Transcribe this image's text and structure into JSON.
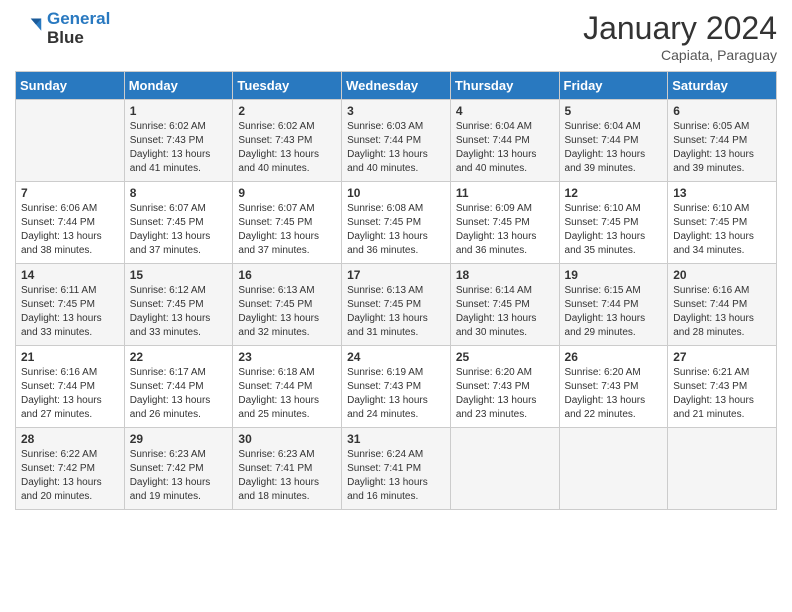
{
  "header": {
    "logo_line1": "General",
    "logo_line2": "Blue",
    "month": "January 2024",
    "location": "Capiata, Paraguay"
  },
  "days_of_week": [
    "Sunday",
    "Monday",
    "Tuesday",
    "Wednesday",
    "Thursday",
    "Friday",
    "Saturday"
  ],
  "weeks": [
    [
      {
        "day": "",
        "sunrise": "",
        "sunset": "",
        "daylight": ""
      },
      {
        "day": "1",
        "sunrise": "6:02 AM",
        "sunset": "7:43 PM",
        "daylight": "13 hours and 41 minutes."
      },
      {
        "day": "2",
        "sunrise": "6:02 AM",
        "sunset": "7:43 PM",
        "daylight": "13 hours and 40 minutes."
      },
      {
        "day": "3",
        "sunrise": "6:03 AM",
        "sunset": "7:44 PM",
        "daylight": "13 hours and 40 minutes."
      },
      {
        "day": "4",
        "sunrise": "6:04 AM",
        "sunset": "7:44 PM",
        "daylight": "13 hours and 40 minutes."
      },
      {
        "day": "5",
        "sunrise": "6:04 AM",
        "sunset": "7:44 PM",
        "daylight": "13 hours and 39 minutes."
      },
      {
        "day": "6",
        "sunrise": "6:05 AM",
        "sunset": "7:44 PM",
        "daylight": "13 hours and 39 minutes."
      }
    ],
    [
      {
        "day": "7",
        "sunrise": "6:06 AM",
        "sunset": "7:44 PM",
        "daylight": "13 hours and 38 minutes."
      },
      {
        "day": "8",
        "sunrise": "6:07 AM",
        "sunset": "7:45 PM",
        "daylight": "13 hours and 37 minutes."
      },
      {
        "day": "9",
        "sunrise": "6:07 AM",
        "sunset": "7:45 PM",
        "daylight": "13 hours and 37 minutes."
      },
      {
        "day": "10",
        "sunrise": "6:08 AM",
        "sunset": "7:45 PM",
        "daylight": "13 hours and 36 minutes."
      },
      {
        "day": "11",
        "sunrise": "6:09 AM",
        "sunset": "7:45 PM",
        "daylight": "13 hours and 36 minutes."
      },
      {
        "day": "12",
        "sunrise": "6:10 AM",
        "sunset": "7:45 PM",
        "daylight": "13 hours and 35 minutes."
      },
      {
        "day": "13",
        "sunrise": "6:10 AM",
        "sunset": "7:45 PM",
        "daylight": "13 hours and 34 minutes."
      }
    ],
    [
      {
        "day": "14",
        "sunrise": "6:11 AM",
        "sunset": "7:45 PM",
        "daylight": "13 hours and 33 minutes."
      },
      {
        "day": "15",
        "sunrise": "6:12 AM",
        "sunset": "7:45 PM",
        "daylight": "13 hours and 33 minutes."
      },
      {
        "day": "16",
        "sunrise": "6:13 AM",
        "sunset": "7:45 PM",
        "daylight": "13 hours and 32 minutes."
      },
      {
        "day": "17",
        "sunrise": "6:13 AM",
        "sunset": "7:45 PM",
        "daylight": "13 hours and 31 minutes."
      },
      {
        "day": "18",
        "sunrise": "6:14 AM",
        "sunset": "7:45 PM",
        "daylight": "13 hours and 30 minutes."
      },
      {
        "day": "19",
        "sunrise": "6:15 AM",
        "sunset": "7:44 PM",
        "daylight": "13 hours and 29 minutes."
      },
      {
        "day": "20",
        "sunrise": "6:16 AM",
        "sunset": "7:44 PM",
        "daylight": "13 hours and 28 minutes."
      }
    ],
    [
      {
        "day": "21",
        "sunrise": "6:16 AM",
        "sunset": "7:44 PM",
        "daylight": "13 hours and 27 minutes."
      },
      {
        "day": "22",
        "sunrise": "6:17 AM",
        "sunset": "7:44 PM",
        "daylight": "13 hours and 26 minutes."
      },
      {
        "day": "23",
        "sunrise": "6:18 AM",
        "sunset": "7:44 PM",
        "daylight": "13 hours and 25 minutes."
      },
      {
        "day": "24",
        "sunrise": "6:19 AM",
        "sunset": "7:43 PM",
        "daylight": "13 hours and 24 minutes."
      },
      {
        "day": "25",
        "sunrise": "6:20 AM",
        "sunset": "7:43 PM",
        "daylight": "13 hours and 23 minutes."
      },
      {
        "day": "26",
        "sunrise": "6:20 AM",
        "sunset": "7:43 PM",
        "daylight": "13 hours and 22 minutes."
      },
      {
        "day": "27",
        "sunrise": "6:21 AM",
        "sunset": "7:43 PM",
        "daylight": "13 hours and 21 minutes."
      }
    ],
    [
      {
        "day": "28",
        "sunrise": "6:22 AM",
        "sunset": "7:42 PM",
        "daylight": "13 hours and 20 minutes."
      },
      {
        "day": "29",
        "sunrise": "6:23 AM",
        "sunset": "7:42 PM",
        "daylight": "13 hours and 19 minutes."
      },
      {
        "day": "30",
        "sunrise": "6:23 AM",
        "sunset": "7:41 PM",
        "daylight": "13 hours and 18 minutes."
      },
      {
        "day": "31",
        "sunrise": "6:24 AM",
        "sunset": "7:41 PM",
        "daylight": "13 hours and 16 minutes."
      },
      {
        "day": "",
        "sunrise": "",
        "sunset": "",
        "daylight": ""
      },
      {
        "day": "",
        "sunrise": "",
        "sunset": "",
        "daylight": ""
      },
      {
        "day": "",
        "sunrise": "",
        "sunset": "",
        "daylight": ""
      }
    ]
  ]
}
